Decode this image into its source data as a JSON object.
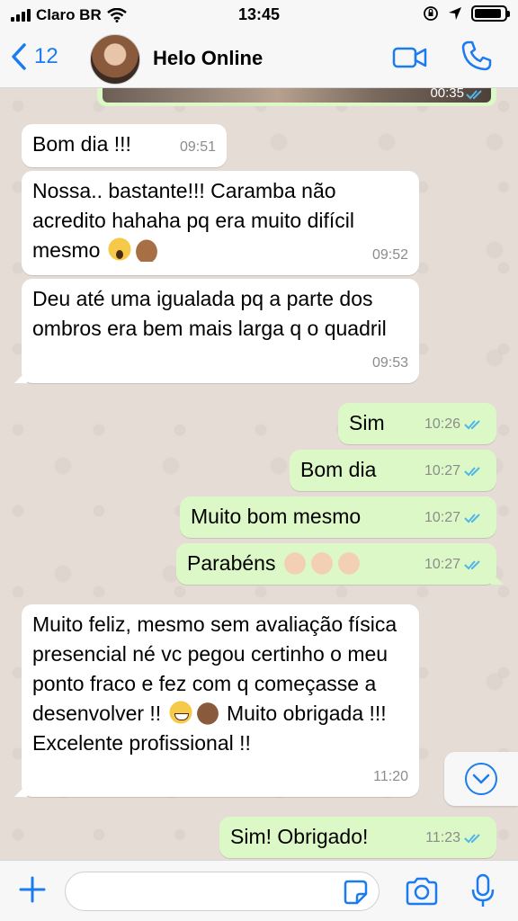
{
  "status_bar": {
    "carrier": "Claro BR",
    "time": "13:45"
  },
  "header": {
    "back_count": "12",
    "contact_name": "Helo Online"
  },
  "media": {
    "duration": "00:35"
  },
  "messages": [
    {
      "direction": "in",
      "text": "Bom dia !!!",
      "time": "09:51"
    },
    {
      "direction": "in",
      "text": "Nossa.. bastante!!! Caramba não acredito hahaha pq era muito difícil mesmo",
      "emojis": [
        "face-screaming-icon",
        "raising-hands-icon"
      ],
      "time": "09:52"
    },
    {
      "direction": "in",
      "text": "Deu até uma igualada pq a parte dos ombros era bem mais larga q o quadril",
      "time": "09:53"
    },
    {
      "direction": "out",
      "text": "Sim",
      "time": "10:26",
      "read": true
    },
    {
      "direction": "out",
      "text": "Bom dia",
      "time": "10:27",
      "read": true
    },
    {
      "direction": "out",
      "text": "Muito bom mesmo",
      "time": "10:27",
      "read": true
    },
    {
      "direction": "out",
      "text": "Parabéns",
      "emojis": [
        "clapping-hands-icon",
        "clapping-hands-icon",
        "clapping-hands-icon"
      ],
      "time": "10:27",
      "read": true
    },
    {
      "direction": "in",
      "text_a": "Muito feliz, mesmo sem avaliação física presencial né vc pegou certinho o meu ponto fraco e fez com q começasse a desenvolver !!",
      "text_b": "Muito obrigada !!! Excelente profissional !!",
      "emojis": [
        "grinning-face-icon",
        "clapping-hands-icon"
      ],
      "time": "11:20"
    },
    {
      "direction": "out",
      "text": "Sim! Obrigado!",
      "time": "11:23",
      "read": true
    }
  ],
  "composer": {
    "placeholder": ""
  },
  "colors": {
    "accent": "#1b7cf0",
    "outgoing_bubble": "#dcf8c6",
    "incoming_bubble": "#ffffff",
    "read_ticks": "#4fb6ec",
    "chat_background": "#e5ddd5"
  }
}
